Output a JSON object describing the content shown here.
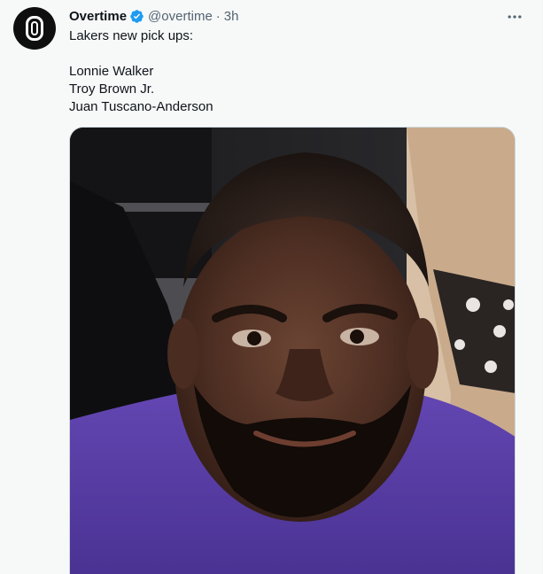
{
  "tweet": {
    "display_name": "Overtime",
    "handle": "@overtime",
    "separator": "·",
    "time": "3h",
    "text_lines": [
      "Lakers new pick ups:",
      "",
      "Lonnie Walker",
      "Troy Brown Jr.",
      "Juan Tuscano-Anderson"
    ],
    "icons": {
      "avatar": "overtime-logo-icon",
      "verified": "verified-badge-icon",
      "more": "more-horizontal-icon"
    },
    "colors": {
      "verified_badge": "#1d9bf0",
      "shirt": "#5a3fa8",
      "background": "#f7f9f9"
    }
  }
}
